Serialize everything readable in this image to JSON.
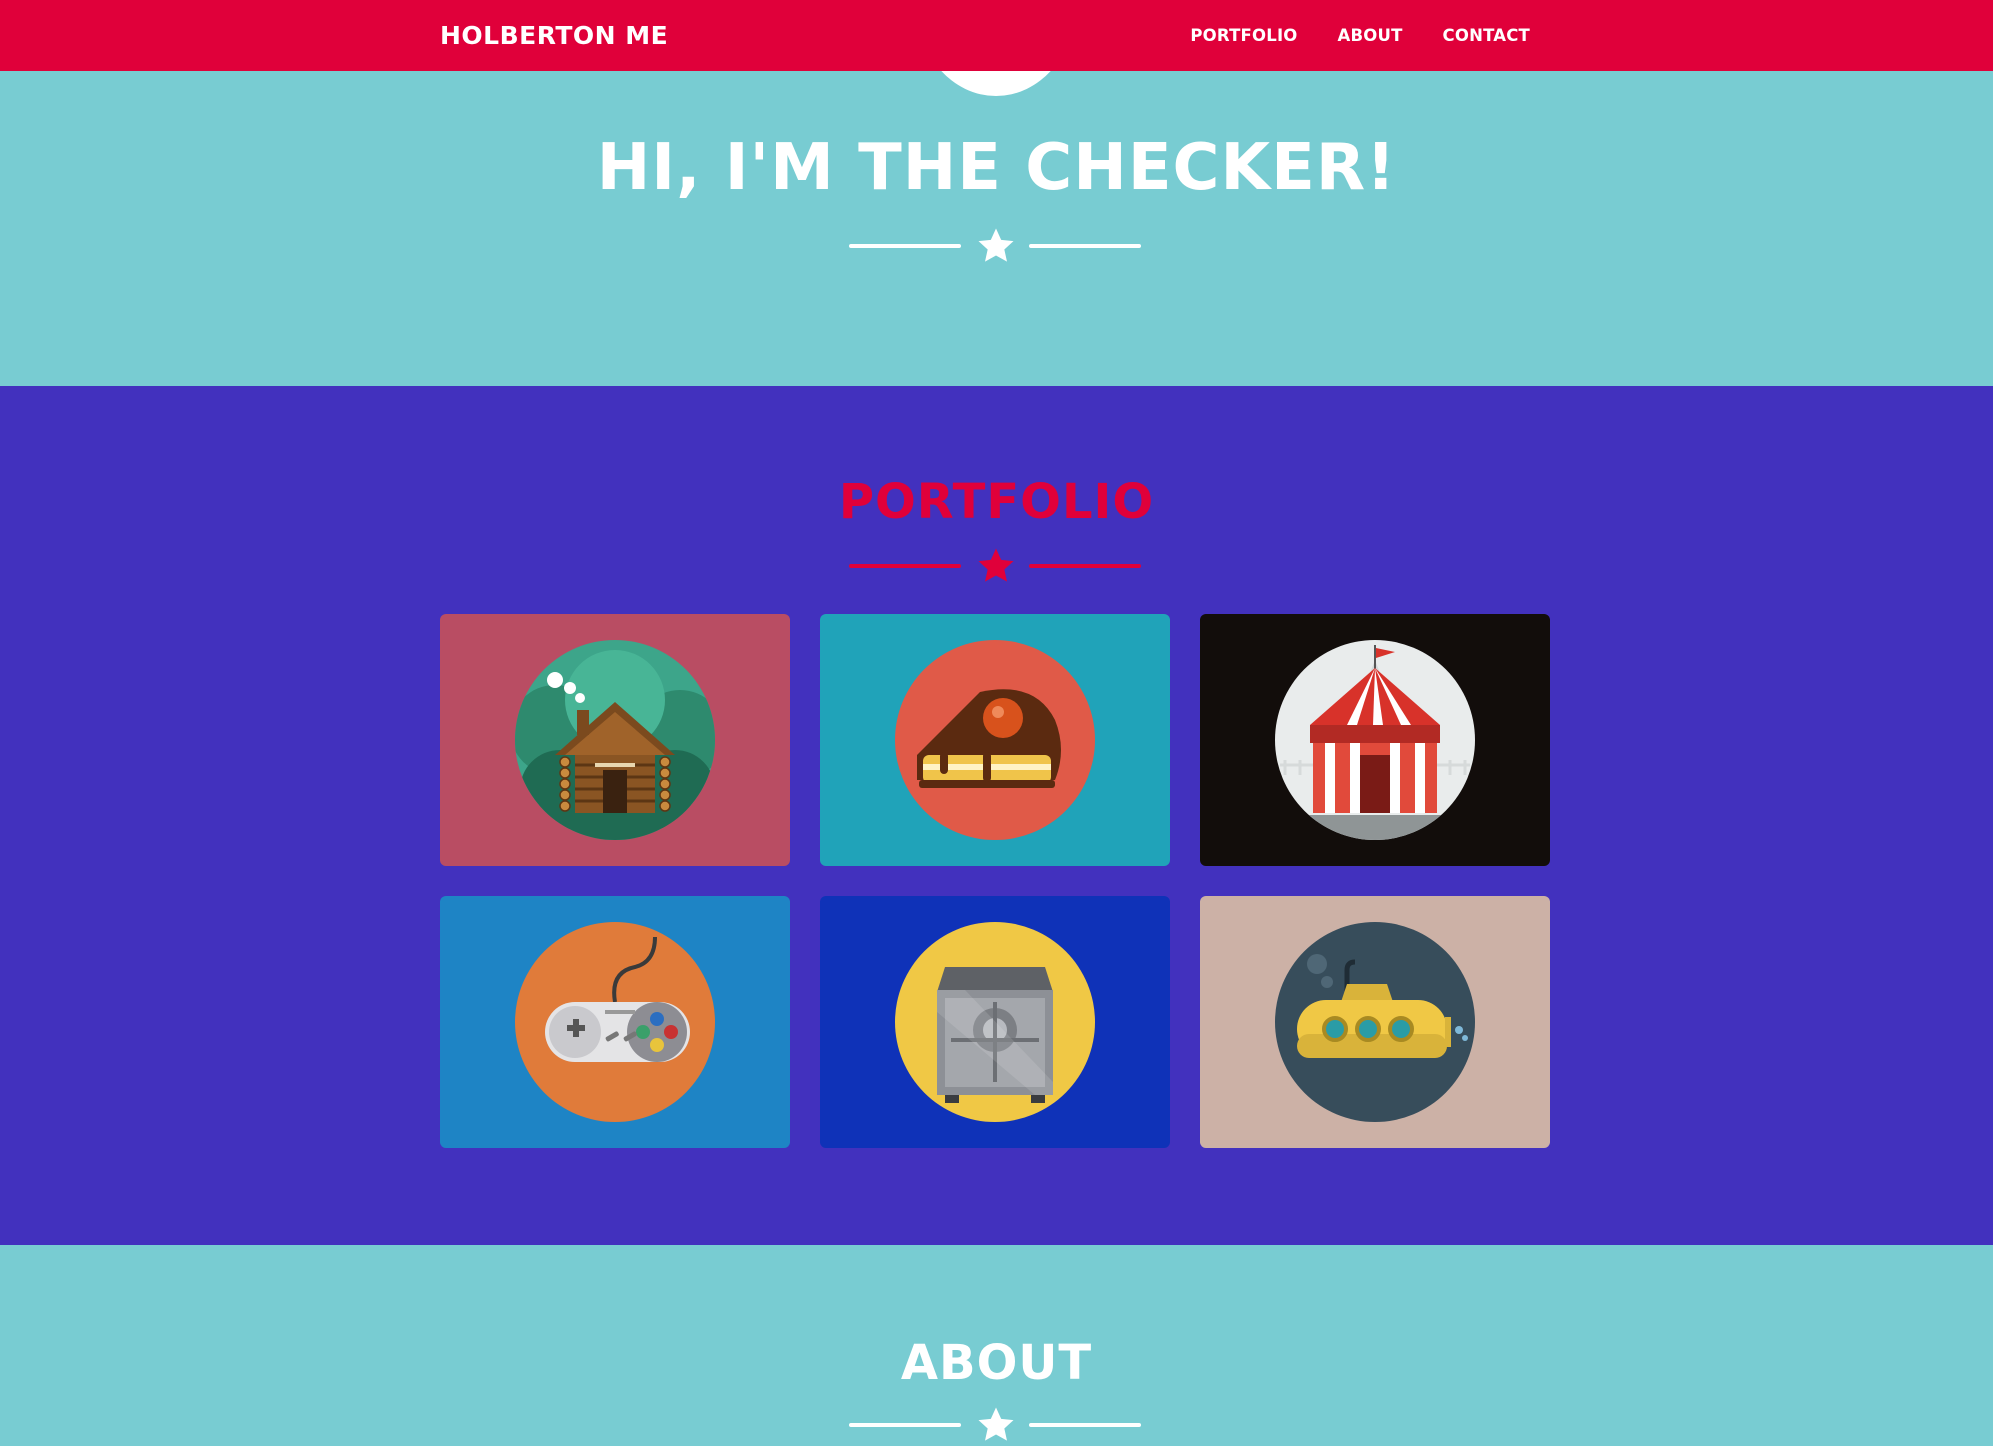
{
  "nav": {
    "brand": "HOLBERTON ME",
    "links": [
      "PORTFOLIO",
      "ABOUT",
      "CONTACT"
    ]
  },
  "hero": {
    "title": "HI, I'M THE CHECKER!"
  },
  "portfolio": {
    "title": "PORTFOLIO",
    "items": [
      {
        "icon": "cabin-icon",
        "bg": "#b94d63",
        "circle": "#3da58a"
      },
      {
        "icon": "cake-icon",
        "bg": "#20a3b9",
        "circle": "#e05a48"
      },
      {
        "icon": "circus-tent-icon",
        "bg": "#120d0b",
        "circle": "#e9ecec"
      },
      {
        "icon": "game-controller-icon",
        "bg": "#1e84c5",
        "circle": "#e07b3a"
      },
      {
        "icon": "safe-icon",
        "bg": "#0f32b8",
        "circle": "#f0c845"
      },
      {
        "icon": "submarine-icon",
        "bg": "#ccb1a6",
        "circle": "#374d5b"
      }
    ]
  },
  "about": {
    "title": "ABOUT"
  },
  "colors": {
    "accent": "#e0003a",
    "teal": "#78ccd2",
    "purple": "#4231be"
  }
}
